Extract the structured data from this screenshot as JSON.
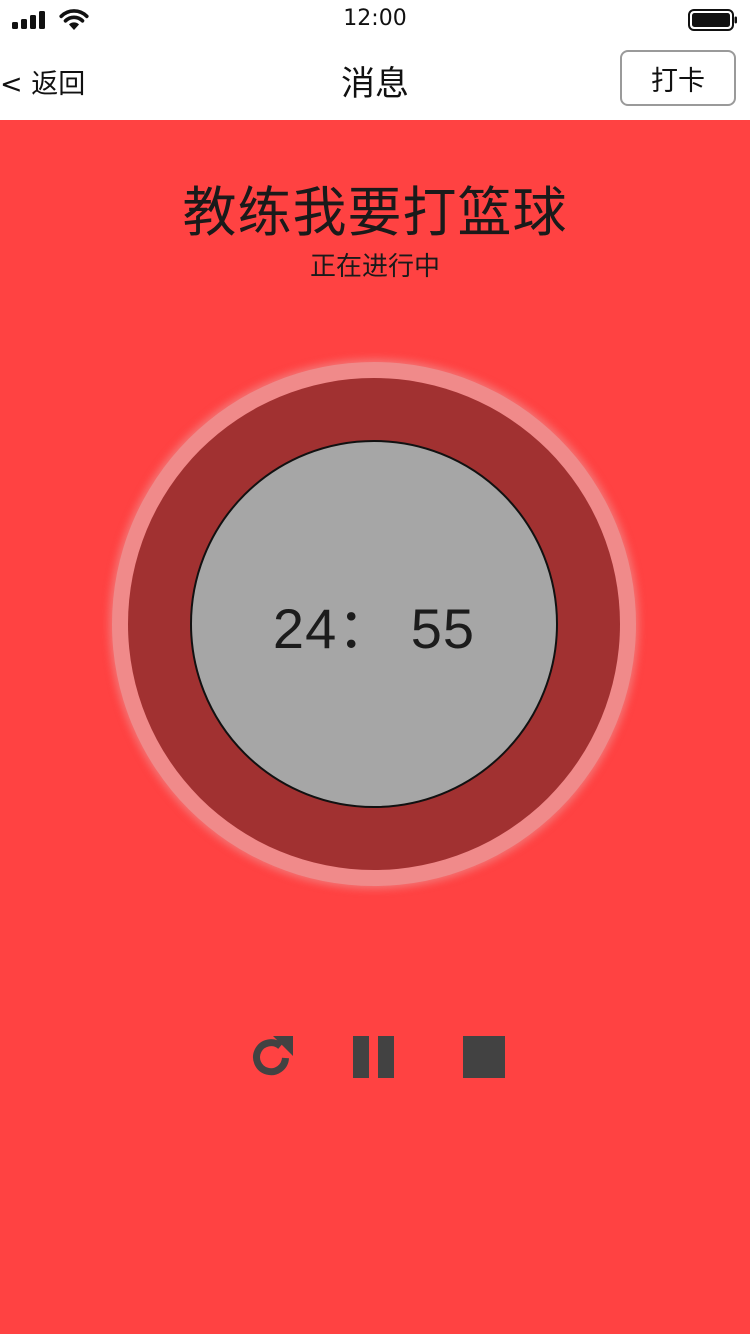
{
  "status_bar": {
    "time": "12:00",
    "icons": [
      "signal-icon",
      "wifi-icon",
      "battery-icon"
    ]
  },
  "nav": {
    "back_label": "< 返回",
    "title": "消息",
    "checkin_label": "打卡"
  },
  "activity": {
    "title": "教练我要打篮球",
    "status": "正在进行中"
  },
  "timer": {
    "display": "24： 55"
  },
  "controls": {
    "icons": [
      "restart-icon",
      "pause-icon",
      "stop-icon"
    ]
  },
  "colors": {
    "background": "#ff4242",
    "glow_ring": "#f08a8a",
    "outer_ring": "#a13131",
    "inner_circle": "#a6a6a6",
    "control_icons": "#424242"
  }
}
